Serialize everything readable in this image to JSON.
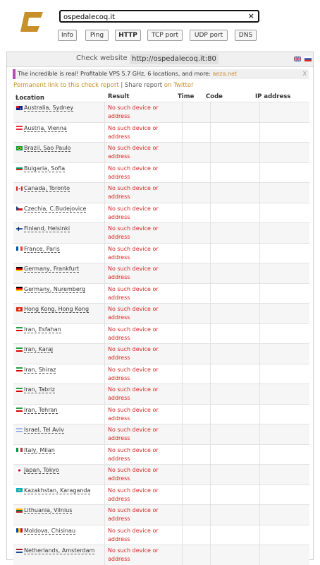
{
  "header": {
    "search_value": "ospedalecoq.it",
    "clear_symbol": "×",
    "buttons": [
      "Info",
      "Ping",
      "HTTP",
      "TCP port",
      "UDP port",
      "DNS"
    ],
    "active_button": "HTTP"
  },
  "panel": {
    "title_label": "Check website",
    "title_url": "http://ospedalecoq.it:80"
  },
  "ad": {
    "text": "The incredible is real! Profitable VPS 5.7 GHz, 6 locations, and more: ",
    "link": "aeza.net",
    "close": "X"
  },
  "permalink": {
    "link_text": "Permanent link to this check report",
    "sep": " | Share report ",
    "twitter": "on Twitter"
  },
  "table": {
    "headers": [
      "Location",
      "Result",
      "Time",
      "Code",
      "IP address"
    ],
    "sort_indicator": "▾",
    "rows": [
      {
        "location": "Australia, Sydney",
        "flag": "au",
        "result": "No such device or address"
      },
      {
        "location": "Austria, Vienna",
        "flag": "at",
        "result": "No such device or address"
      },
      {
        "location": "Brazil, Sao Paulo",
        "flag": "br",
        "result": "No such device or address"
      },
      {
        "location": "Bulgaria, Sofia",
        "flag": "bg",
        "result": "No such device or address"
      },
      {
        "location": "Canada, Toronto",
        "flag": "ca",
        "result": "No such device or address"
      },
      {
        "location": "Czechia, C.Budejovice",
        "flag": "cz",
        "result": "No such device or address"
      },
      {
        "location": "Finland, Helsinki",
        "flag": "fi",
        "result": "No such device or address"
      },
      {
        "location": "France, Paris",
        "flag": "fr",
        "result": "No such device or address"
      },
      {
        "location": "Germany, Frankfurt",
        "flag": "de",
        "result": "No such device or address"
      },
      {
        "location": "Germany, Nuremberg",
        "flag": "de",
        "result": "No such device or address"
      },
      {
        "location": "Hong Kong, Hong Kong",
        "flag": "hk",
        "result": "No such device or address"
      },
      {
        "location": "Iran, Esfahan",
        "flag": "ir",
        "result": "No such device or address"
      },
      {
        "location": "Iran, Karaj",
        "flag": "ir",
        "result": "No such device or address"
      },
      {
        "location": "Iran, Shiraz",
        "flag": "ir",
        "result": "No such device or address"
      },
      {
        "location": "Iran, Tabriz",
        "flag": "ir",
        "result": "No such device or address"
      },
      {
        "location": "Iran, Tehran",
        "flag": "ir",
        "result": "No such device or address"
      },
      {
        "location": "Israel, Tel Aviv",
        "flag": "il",
        "result": "No such device or address"
      },
      {
        "location": "Italy, Milan",
        "flag": "it",
        "result": "No such device or address"
      },
      {
        "location": "Japan, Tokyo",
        "flag": "jp",
        "result": "No such device or address"
      },
      {
        "location": "Kazakhstan, Karaganda",
        "flag": "kz",
        "result": "No such device or address"
      },
      {
        "location": "Lithuania, Vilnius",
        "flag": "lt",
        "result": "No such device or address"
      },
      {
        "location": "Moldova, Chisinau",
        "flag": "md",
        "result": "No such device or address"
      },
      {
        "location": "Netherlands, Amsterdam",
        "flag": "nl",
        "result": "No such device or address"
      }
    ]
  },
  "colors": {
    "accent_gold": "#c8902a",
    "error_red": "#dd2222",
    "ad_bar": "#b44cb4"
  }
}
